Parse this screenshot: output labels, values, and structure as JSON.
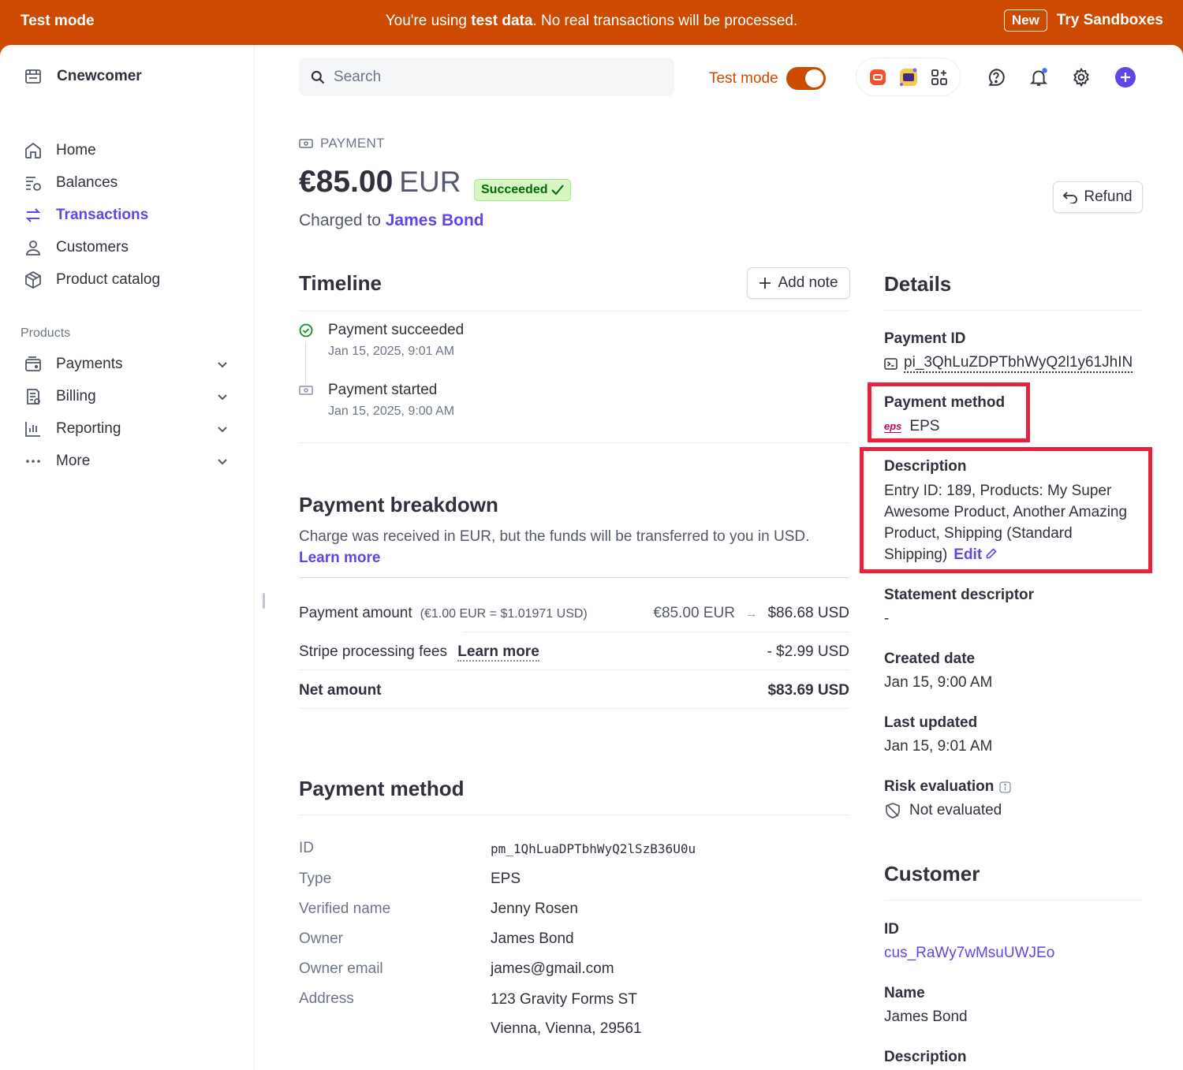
{
  "banner": {
    "left": "Test mode",
    "msg_pre": "You're using ",
    "msg_bold": "test data",
    "msg_post": ". No real transactions will be processed.",
    "new_badge": "New",
    "try_link": "Try Sandboxes"
  },
  "sidebar": {
    "account": "Cnewcomer",
    "nav": [
      {
        "label": "Home",
        "icon": "home-icon"
      },
      {
        "label": "Balances",
        "icon": "balances-icon"
      },
      {
        "label": "Transactions",
        "icon": "transactions-icon",
        "active": true
      },
      {
        "label": "Customers",
        "icon": "user-icon"
      },
      {
        "label": "Product catalog",
        "icon": "box-icon"
      }
    ],
    "products_label": "Products",
    "products": [
      {
        "label": "Payments",
        "icon": "wallet-icon"
      },
      {
        "label": "Billing",
        "icon": "billing-icon"
      },
      {
        "label": "Reporting",
        "icon": "chart-icon"
      },
      {
        "label": "More",
        "icon": "ellipsis-icon"
      }
    ]
  },
  "header": {
    "search_placeholder": "Search",
    "test_mode_label": "Test mode",
    "test_mode_on": true
  },
  "payment": {
    "crumb": "PAYMENT",
    "amount": "€85.00",
    "currency": "EUR",
    "status": "Succeeded",
    "charged_to_label": "Charged to",
    "charged_to_name": "James Bond",
    "refund_label": "Refund"
  },
  "timeline": {
    "title": "Timeline",
    "add_note": "Add note",
    "events": [
      {
        "title": "Payment succeeded",
        "time": "Jan 15, 2025, 9:01 AM"
      },
      {
        "title": "Payment started",
        "time": "Jan 15, 2025, 9:00 AM"
      }
    ]
  },
  "breakdown": {
    "title": "Payment breakdown",
    "text": "Charge was received in EUR, but the funds will be transferred to you in USD.",
    "learn_more": "Learn more",
    "rows": {
      "amount_label": "Payment amount",
      "amount_rate": "(€1.00 EUR = $1.01971 USD)",
      "amount_from": "€85.00 EUR",
      "amount_to": "$86.68 USD",
      "fees_label": "Stripe processing fees",
      "fees_link": "Learn more",
      "fees_value": "- $2.99 USD",
      "net_label": "Net amount",
      "net_value": "$83.69 USD"
    }
  },
  "payment_method": {
    "title": "Payment method",
    "fields": [
      {
        "key": "ID",
        "value": "pm_1QhLuaDPTbhWyQ2lSzB36U0u"
      },
      {
        "key": "Type",
        "value": "EPS"
      },
      {
        "key": "Verified name",
        "value": "Jenny Rosen"
      },
      {
        "key": "Owner",
        "value": "James Bond"
      },
      {
        "key": "Owner email",
        "value": "james@gmail.com"
      },
      {
        "key": "Address",
        "value": "123 Gravity Forms ST"
      }
    ],
    "address_line2": "Vienna, Vienna, 29561"
  },
  "details": {
    "title": "Details",
    "payment_id_label": "Payment ID",
    "payment_id": "pi_3QhLuZDPTbhWyQ2l1y61JhIN",
    "payment_method_label": "Payment method",
    "payment_method_logo": "eps",
    "payment_method": "EPS",
    "description_label": "Description",
    "description": "Entry ID: 189, Products: My Super Awesome Product, Another Amazing Product, Shipping (Standard Shipping)",
    "edit": "Edit",
    "statement_label": "Statement descriptor",
    "statement": "-",
    "created_label": "Created date",
    "created": "Jan 15, 9:00 AM",
    "updated_label": "Last updated",
    "updated": "Jan 15, 9:01 AM",
    "risk_label": "Risk evaluation",
    "risk": "Not evaluated"
  },
  "customer": {
    "title": "Customer",
    "id_label": "ID",
    "id": "cus_RaWy7wMsuUWJEo",
    "name_label": "Name",
    "name": "James Bond",
    "description_label": "Description"
  },
  "colors": {
    "banner": "#cc4b00",
    "accent": "#5f46e8",
    "success_bg": "#d7f7c2",
    "success_text": "#05690d",
    "highlight": "#e8213d"
  }
}
